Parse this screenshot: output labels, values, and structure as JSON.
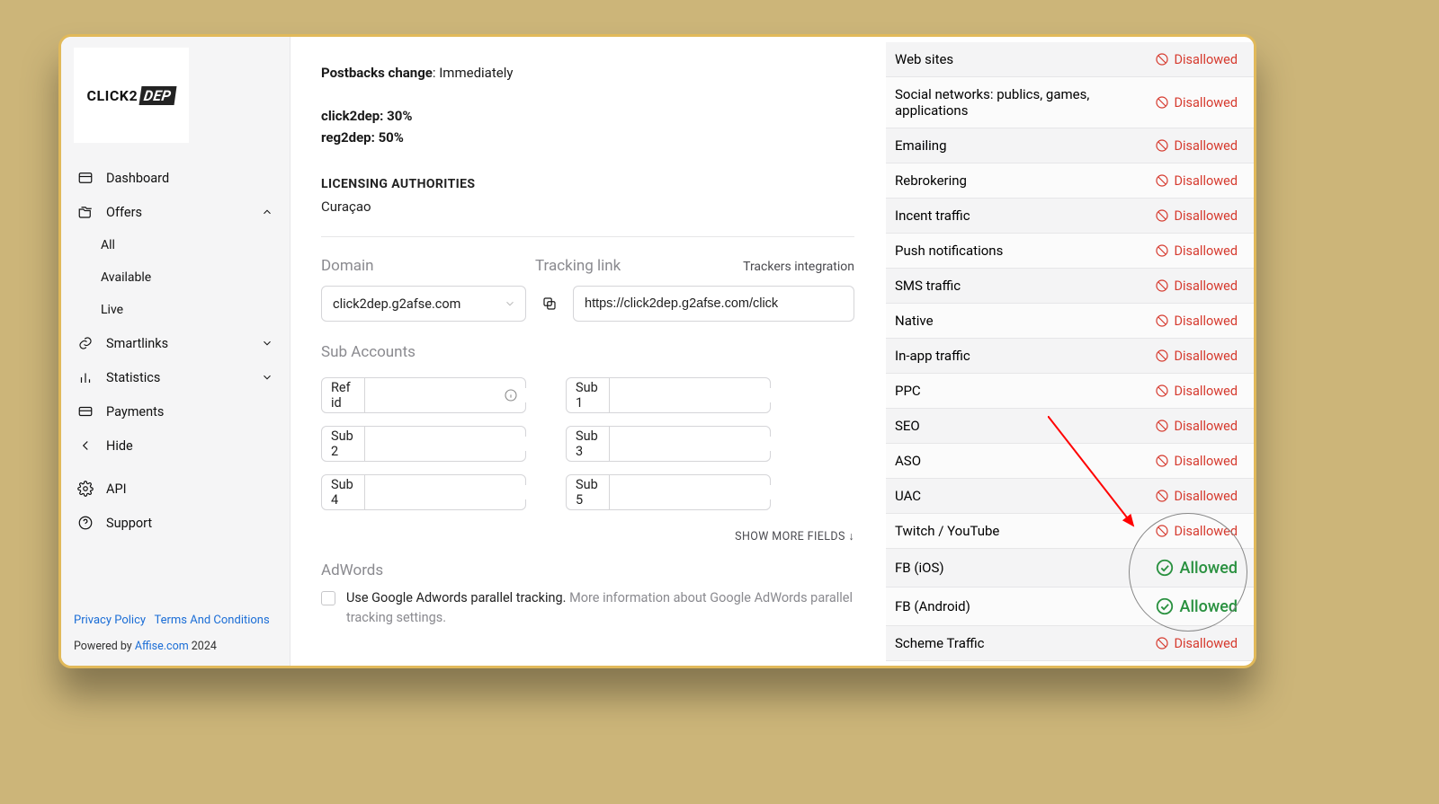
{
  "logo": {
    "part1": "CLICK2",
    "part2": "DEP"
  },
  "sidebar": {
    "items": [
      {
        "label": "Dashboard"
      },
      {
        "label": "Offers"
      },
      {
        "label": "Smartlinks"
      },
      {
        "label": "Statistics"
      },
      {
        "label": "Payments"
      },
      {
        "label": "Hide"
      },
      {
        "label": "API"
      },
      {
        "label": "Support"
      }
    ],
    "offersSub": [
      {
        "label": "All"
      },
      {
        "label": "Available"
      },
      {
        "label": "Live"
      }
    ],
    "privacy": "Privacy Policy",
    "terms": "Terms And Conditions",
    "powered_prefix": "Powered by ",
    "powered_link": "Affise.com",
    "powered_year": " 2024"
  },
  "info": {
    "postbacks_label": "Postbacks change",
    "postbacks_value": ": Immediately",
    "rate1_label": "click2dep: ",
    "rate1_value": "30%",
    "rate2_label": "reg2dep: ",
    "rate2_value": "50%"
  },
  "licensing": {
    "heading": "LICENSING AUTHORITIES",
    "value": "Curaçao"
  },
  "tracking": {
    "domain_label": "Domain",
    "tracking_label": "Tracking link",
    "trackers_integration": "Trackers integration",
    "domain_value": "click2dep.g2afse.com",
    "tracking_value": "https://click2dep.g2afse.com/click",
    "sub_heading": "Sub Accounts",
    "fields": {
      "refid": "Ref id",
      "sub1": "Sub 1",
      "sub2": "Sub 2",
      "sub3": "Sub 3",
      "sub4": "Sub 4",
      "sub5": "Sub 5"
    },
    "show_more": "SHOW MORE FIELDS ↓",
    "adwords_heading": "AdWords",
    "adwords_main": "Use Google Adwords parallel tracking. ",
    "adwords_muted": "More information about Google AdWords parallel tracking settings."
  },
  "traffic_rows": [
    {
      "name": "Web sites",
      "status": "Disallowed"
    },
    {
      "name": "Social networks: publics, games, applications",
      "status": "Disallowed"
    },
    {
      "name": "Emailing",
      "status": "Disallowed"
    },
    {
      "name": "Rebrokering",
      "status": "Disallowed"
    },
    {
      "name": "Incent traffic",
      "status": "Disallowed"
    },
    {
      "name": "Push notifications",
      "status": "Disallowed"
    },
    {
      "name": "SMS traffic",
      "status": "Disallowed"
    },
    {
      "name": "Native",
      "status": "Disallowed"
    },
    {
      "name": "In-app traffic",
      "status": "Disallowed"
    },
    {
      "name": "PPC",
      "status": "Disallowed"
    },
    {
      "name": "SEO",
      "status": "Disallowed"
    },
    {
      "name": "ASO",
      "status": "Disallowed"
    },
    {
      "name": "UAC",
      "status": "Disallowed"
    },
    {
      "name": "Twitch / YouTube",
      "status": "Disallowed"
    },
    {
      "name": "FB (iOS)",
      "status": "Allowed"
    },
    {
      "name": "FB (Android)",
      "status": "Allowed"
    },
    {
      "name": "Scheme Traffic",
      "status": "Disallowed"
    }
  ]
}
